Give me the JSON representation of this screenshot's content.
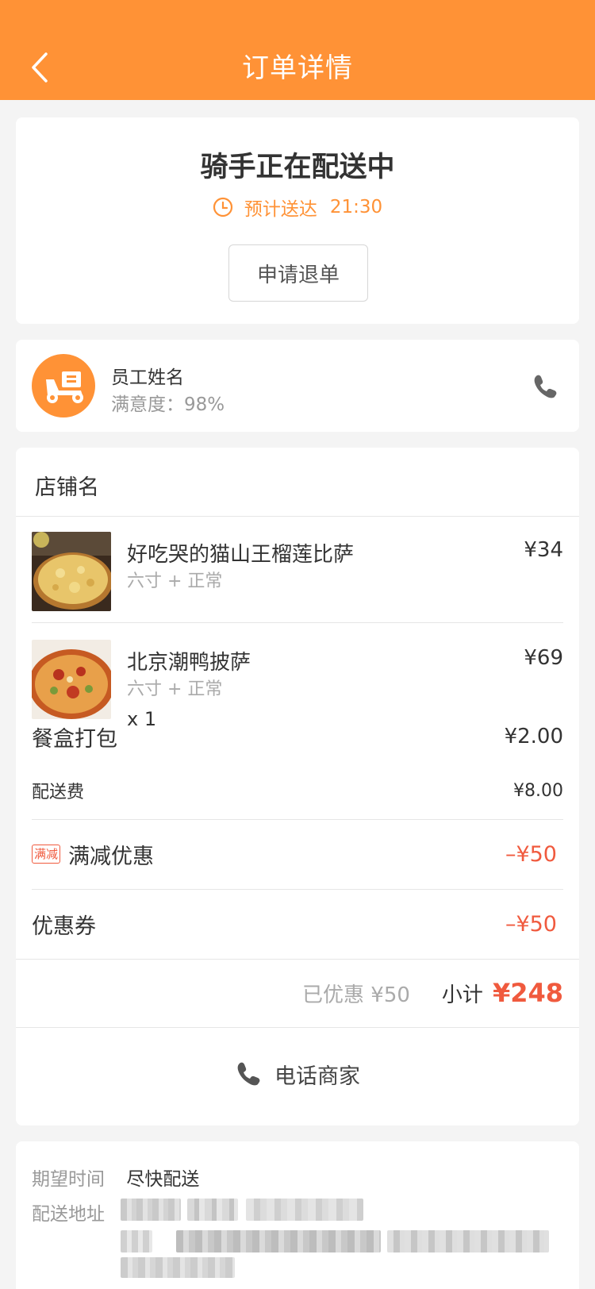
{
  "header": {
    "title": "订单详情"
  },
  "status": {
    "title": "骑手正在配送中",
    "eta_label": "预计送达",
    "eta_time": "21:30",
    "cancel_button": "申请退单"
  },
  "rider": {
    "name": "员工姓名",
    "satisfaction": "满意度：98%"
  },
  "order": {
    "shop_name": "店铺名",
    "items": [
      {
        "name": "好吃哭的猫山王榴莲比萨",
        "spec": "六寸 + 正常",
        "qty": "",
        "price": "¥34"
      },
      {
        "name": "北京潮鸭披萨",
        "spec": "六寸 + 正常",
        "qty": "x 1",
        "price": "¥69"
      }
    ],
    "packaging": {
      "label": "餐盒打包",
      "value": "¥2.00"
    },
    "delivery_fee": {
      "label": "配送费",
      "value": "¥8.00"
    },
    "full_reduction": {
      "tag": "满减",
      "label": "满减优惠",
      "value": "–¥50"
    },
    "coupon": {
      "label": "优惠券",
      "value": "–¥50"
    },
    "saved": "已优惠 ¥50",
    "subtotal_label": "小计",
    "subtotal_value": "¥248",
    "call_shop": "电话商家"
  },
  "delivery": {
    "time_label": "期望时间",
    "time_value": "尽快配送",
    "address_label": "配送地址"
  },
  "colors": {
    "brand": "#ff9236",
    "discount": "#f05a3e"
  }
}
